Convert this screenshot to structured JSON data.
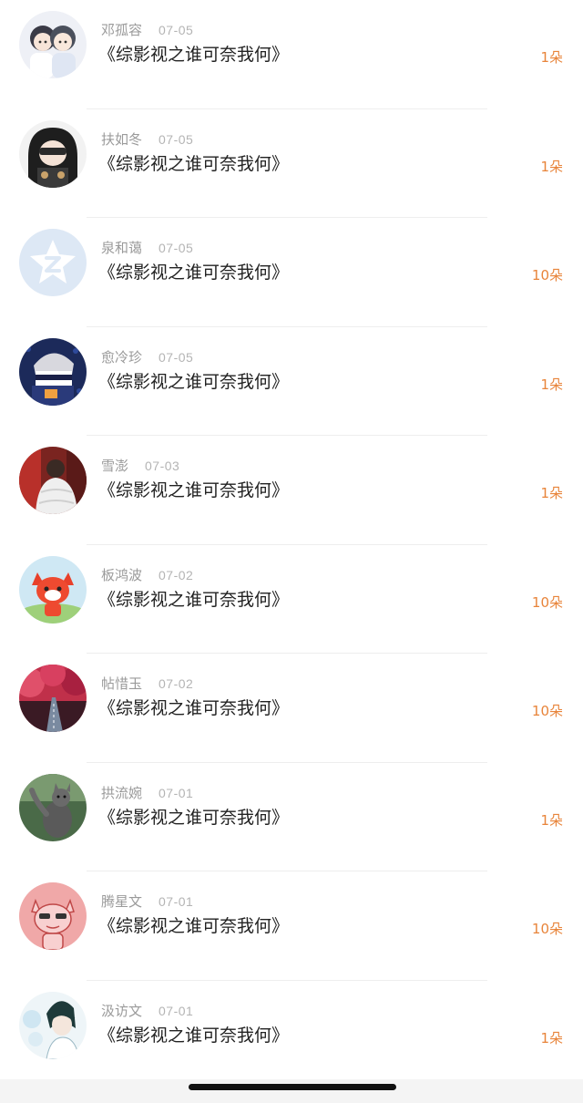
{
  "records": [
    {
      "name": "邓孤容",
      "date": "07-05",
      "title": "《综影视之谁可奈我何》",
      "amount": "1朵",
      "avatar_icon": "anime-couple-avatar"
    },
    {
      "name": "扶如冬",
      "date": "07-05",
      "title": "《综影视之谁可奈我何》",
      "amount": "1朵",
      "avatar_icon": "anime-girl-avatar"
    },
    {
      "name": "泉和蔼",
      "date": "07-05",
      "title": "《综影视之谁可奈我何》",
      "amount": "10朵",
      "avatar_icon": "default-qq-avatar"
    },
    {
      "name": "愈冷珍",
      "date": "07-05",
      "title": "《综影视之谁可奈我何》",
      "amount": "1朵",
      "avatar_icon": "ninja-avatar"
    },
    {
      "name": "雪澎",
      "date": "07-03",
      "title": "《综影视之谁可奈我何》",
      "amount": "1朵",
      "avatar_icon": "photo-person-avatar"
    },
    {
      "name": "板鸿波",
      "date": "07-02",
      "title": "《综影视之谁可奈我何》",
      "amount": "10朵",
      "avatar_icon": "red-fox-avatar"
    },
    {
      "name": "帖惜玉",
      "date": "07-02",
      "title": "《综影视之谁可奈我何》",
      "amount": "10朵",
      "avatar_icon": "red-forest-road-avatar"
    },
    {
      "name": "拱流婉",
      "date": "07-01",
      "title": "《综影视之谁可奈我何》",
      "amount": "1朵",
      "avatar_icon": "cat-avatar"
    },
    {
      "name": "腾星文",
      "date": "07-01",
      "title": "《综影视之谁可奈我何》",
      "amount": "10朵",
      "avatar_icon": "pink-cat-avatar"
    },
    {
      "name": "汲访文",
      "date": "07-01",
      "title": "《综影视之谁可奈我何》",
      "amount": "1朵",
      "avatar_icon": "anime-character-avatar"
    }
  ],
  "colors": {
    "accent": "#e8843a",
    "name_text": "#9a9a9a",
    "title_text": "#222222"
  }
}
